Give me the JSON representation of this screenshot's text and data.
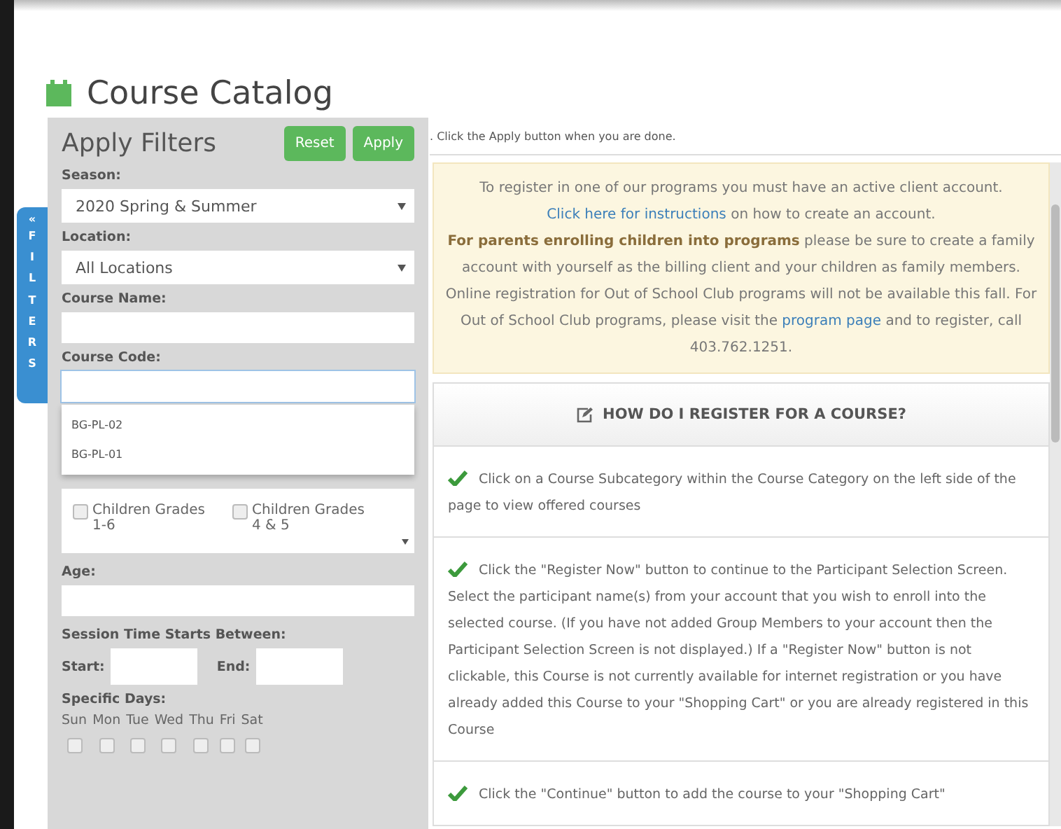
{
  "page": {
    "title": "Course Catalog"
  },
  "filters_tab": {
    "arrow": "«",
    "label": "FILTERS"
  },
  "filters": {
    "title": "Apply Filters",
    "buttons": [
      "Reset",
      "Apply"
    ],
    "season": {
      "label": "Season:",
      "value": "2020 Spring & Summer"
    },
    "location": {
      "label": "Location:",
      "value": "All Locations"
    },
    "course_name": {
      "label": "Course Name:"
    },
    "course_code": {
      "label": "Course Code:",
      "suggestions": [
        "BG-PL-02",
        "BG-PL-01"
      ]
    },
    "categories": [
      {
        "label": "Children Grades 1-6",
        "checked": false
      },
      {
        "label": "Children Grades 4 & 5",
        "checked": false
      }
    ],
    "age": {
      "label": "Age:"
    },
    "session_time": {
      "label": "Session Time Starts Between:",
      "start_label": "Start:",
      "end_label": "End:"
    },
    "days": {
      "label": "Specific Days:",
      "items": [
        {
          "label": "Sun",
          "checked": false
        },
        {
          "label": "Mon",
          "checked": false
        },
        {
          "label": "Tue",
          "checked": false
        },
        {
          "label": "Wed",
          "checked": false
        },
        {
          "label": "Thu",
          "checked": false
        },
        {
          "label": "Fri",
          "checked": false
        },
        {
          "label": "Sat",
          "checked": false
        }
      ]
    }
  },
  "hint": ". Click the Apply button when you are done.",
  "notice": {
    "text": "To register in one of our programs you must have an active client account. ",
    "link1": "Click here for instructions",
    "text2": " on how to create an account.",
    "text3": "**For parents enrolling children into programs** please be sure to create a family account with yourself as the billing client and your children as family members. Online registration for Out of School Club programs will not be available this fall. For Out of School Club programs, please visit the ",
    "link2": "program page",
    "text4": " and to register, call 403.762.1251."
  },
  "howto": {
    "title": "HOW DO I REGISTER FOR A COURSE?",
    "steps": [
      "Click on a Course Subcategory within the Course Category on the left side of the page to view offered courses",
      "Click the \"Register Now\" button to continue to the Participant Selection Screen. Select the participant name(s) from your account that you wish to enroll into the selected course. (If you have not added Group Members to your account then the Participant Selection Screen is not displayed.) If a \"Register Now\" button is not clickable, this Course is not currently available for internet registration or you have already added this Course to your \"Shopping Cart\" or you are already registered in this Course",
      "Click the \"Continue\" button to add the course to your \"Shopping Cart\""
    ]
  }
}
